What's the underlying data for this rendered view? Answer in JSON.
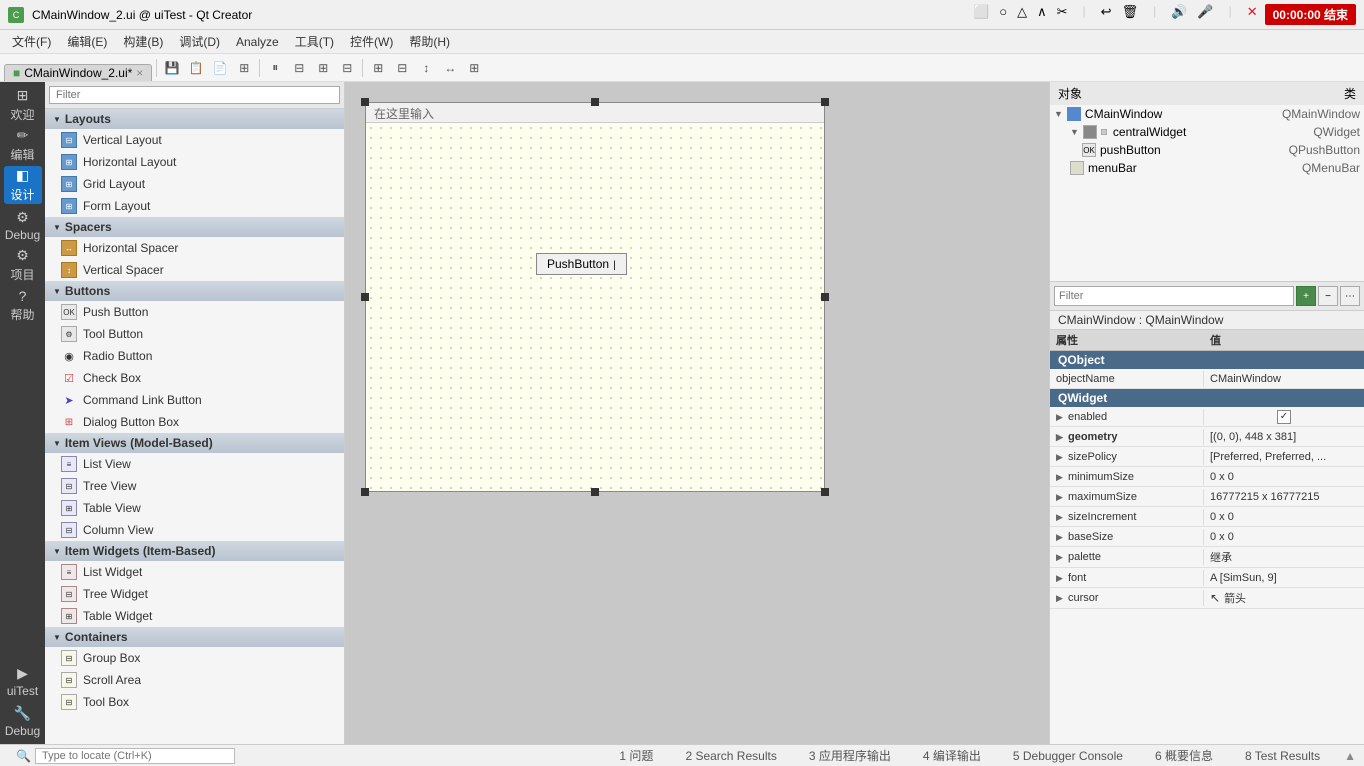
{
  "titlebar": {
    "title": "CMainWindow_2.ui @ uiTest - Qt Creator",
    "icon_color": "#4a9d4a"
  },
  "menubar": {
    "items": [
      "文件(F)",
      "编辑(E)",
      "构建(B)",
      "调试(D)",
      "Analyze",
      "工具(T)",
      "控件(W)",
      "帮助(H)"
    ]
  },
  "tab": {
    "label": "CMainWindow_2.ui*",
    "close": "×"
  },
  "left_sidebar": {
    "items": [
      {
        "name": "欢迎",
        "icon": "⊞"
      },
      {
        "name": "编辑",
        "icon": "✏"
      },
      {
        "name": "设计",
        "icon": "◧",
        "active": true
      },
      {
        "name": "Debug",
        "icon": "🐛"
      },
      {
        "name": "项目",
        "icon": "⚙"
      },
      {
        "name": "帮助",
        "icon": "?"
      },
      {
        "name": "uiTest",
        "icon": "▶"
      },
      {
        "name": "Debug",
        "icon": "🔧"
      }
    ]
  },
  "widget_panel": {
    "filter_placeholder": "Filter",
    "categories": [
      {
        "name": "Layouts",
        "items": [
          {
            "label": "Vertical Layout",
            "icon": "⊟"
          },
          {
            "label": "Horizontal Layout",
            "icon": "⊞"
          },
          {
            "label": "Grid Layout",
            "icon": "⊞"
          },
          {
            "label": "Form Layout",
            "icon": "⊞"
          }
        ]
      },
      {
        "name": "Spacers",
        "items": [
          {
            "label": "Horizontal Spacer",
            "icon": "↔"
          },
          {
            "label": "Vertical Spacer",
            "icon": "↕"
          }
        ]
      },
      {
        "name": "Buttons",
        "items": [
          {
            "label": "Push Button",
            "icon": "OK"
          },
          {
            "label": "Tool Button",
            "icon": "⚙"
          },
          {
            "label": "Radio Button",
            "icon": "◉"
          },
          {
            "label": "Check Box",
            "icon": "☑"
          },
          {
            "label": "Command Link Button",
            "icon": "➤"
          },
          {
            "label": "Dialog Button Box",
            "icon": "⊞"
          }
        ]
      },
      {
        "name": "Item Views (Model-Based)",
        "items": [
          {
            "label": "List View",
            "icon": "≡"
          },
          {
            "label": "Tree View",
            "icon": "🌲"
          },
          {
            "label": "Table View",
            "icon": "⊞"
          },
          {
            "label": "Column View",
            "icon": "⊟"
          }
        ]
      },
      {
        "name": "Item Widgets (Item-Based)",
        "items": [
          {
            "label": "List Widget",
            "icon": "≡"
          },
          {
            "label": "Tree Widget",
            "icon": "🌲"
          },
          {
            "label": "Table Widget",
            "icon": "⊞"
          }
        ]
      },
      {
        "name": "Containers",
        "items": [
          {
            "label": "Group Box",
            "icon": "⊟"
          },
          {
            "label": "Scroll Area",
            "icon": "⊟"
          },
          {
            "label": "Tool Box",
            "icon": "⊟"
          }
        ]
      }
    ]
  },
  "canvas": {
    "placeholder": "在这里输入",
    "button_label": "PushButton",
    "cursor_visible": true
  },
  "object_inspector": {
    "header_left": "对象",
    "header_right": "类",
    "tree": [
      {
        "indent": 0,
        "expand": true,
        "name": "CMainWindow",
        "type": "QMainWindow"
      },
      {
        "indent": 1,
        "expand": true,
        "name": "centralWidget",
        "type": "QWidget",
        "has_icon": true
      },
      {
        "indent": 2,
        "expand": false,
        "name": "pushButton",
        "type": "QPushButton"
      },
      {
        "indent": 1,
        "expand": false,
        "name": "menuBar",
        "type": "QMenuBar"
      }
    ]
  },
  "properties": {
    "filter_placeholder": "Filter",
    "context_label": "CMainWindow : QMainWindow",
    "col_attr": "属性",
    "col_value": "值",
    "groups": [
      {
        "name": "QObject",
        "props": [
          {
            "name": "objectName",
            "bold": false,
            "value": "CMainWindow",
            "type": "text"
          }
        ]
      },
      {
        "name": "QWidget",
        "props": [
          {
            "name": "enabled",
            "bold": false,
            "value": "✓",
            "type": "check",
            "expand": true
          },
          {
            "name": "geometry",
            "bold": true,
            "value": "[(0, 0), 448 x 381]",
            "type": "text",
            "expand": true
          },
          {
            "name": "sizePolicy",
            "bold": false,
            "value": "[Preferred, Preferred, ...",
            "type": "text",
            "expand": true
          },
          {
            "name": "minimumSize",
            "bold": false,
            "value": "0 x 0",
            "type": "text",
            "expand": true
          },
          {
            "name": "maximumSize",
            "bold": false,
            "value": "16777215 x 16777215",
            "type": "text",
            "expand": true
          },
          {
            "name": "sizeIncrement",
            "bold": false,
            "value": "0 x 0",
            "type": "text",
            "expand": true
          },
          {
            "name": "baseSize",
            "bold": false,
            "value": "0 x 0",
            "type": "text",
            "expand": true
          },
          {
            "name": "palette",
            "bold": false,
            "value": "继承",
            "type": "text",
            "expand": true
          },
          {
            "name": "font",
            "bold": false,
            "value": "A  [SimSun, 9]",
            "type": "text",
            "expand": true
          },
          {
            "name": "cursor",
            "bold": false,
            "value": "箭头",
            "type": "text",
            "expand": true
          }
        ]
      }
    ]
  },
  "statusbar": {
    "tabs": [
      "1  问题",
      "2  Search Results",
      "3  应用程序输出",
      "4  编译输出",
      "5  Debugger Console",
      "6  概要信息",
      "8  Test Results"
    ],
    "input_placeholder": "Type to locate (Ctrl+K)",
    "time": "00:00:00 结束"
  }
}
